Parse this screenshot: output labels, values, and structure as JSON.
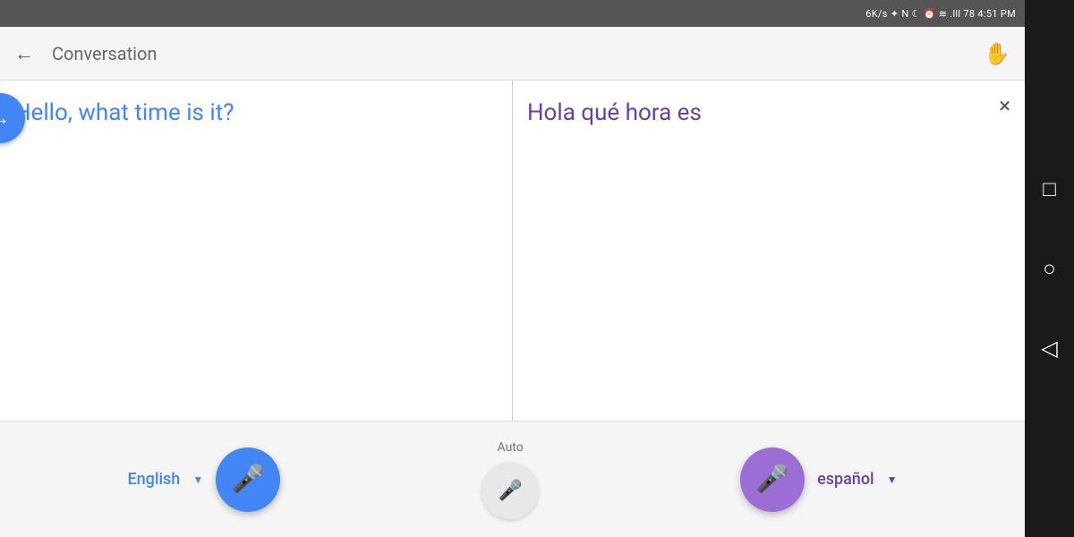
{
  "statusBar": {
    "text": "6K/s ✦ N ☾ ⏰ ≋ .lll 78 4:51 PM"
  },
  "topBar": {
    "title": "Conversation",
    "backArrow": "←",
    "handIcon": "✋"
  },
  "leftPanel": {
    "sourceText": "Hello, what time is it?"
  },
  "rightPanel": {
    "translatedText": "Hola qué hora es",
    "closeLabel": "×"
  },
  "arrowButton": {
    "icon": "→"
  },
  "bottomBar": {
    "englishLabel": "English",
    "spanishLabel": "español",
    "autoLabel": "Auto",
    "dropdownArrow": "▼"
  },
  "navBar": {
    "square": "□",
    "circle": "○",
    "triangle": "◁"
  }
}
